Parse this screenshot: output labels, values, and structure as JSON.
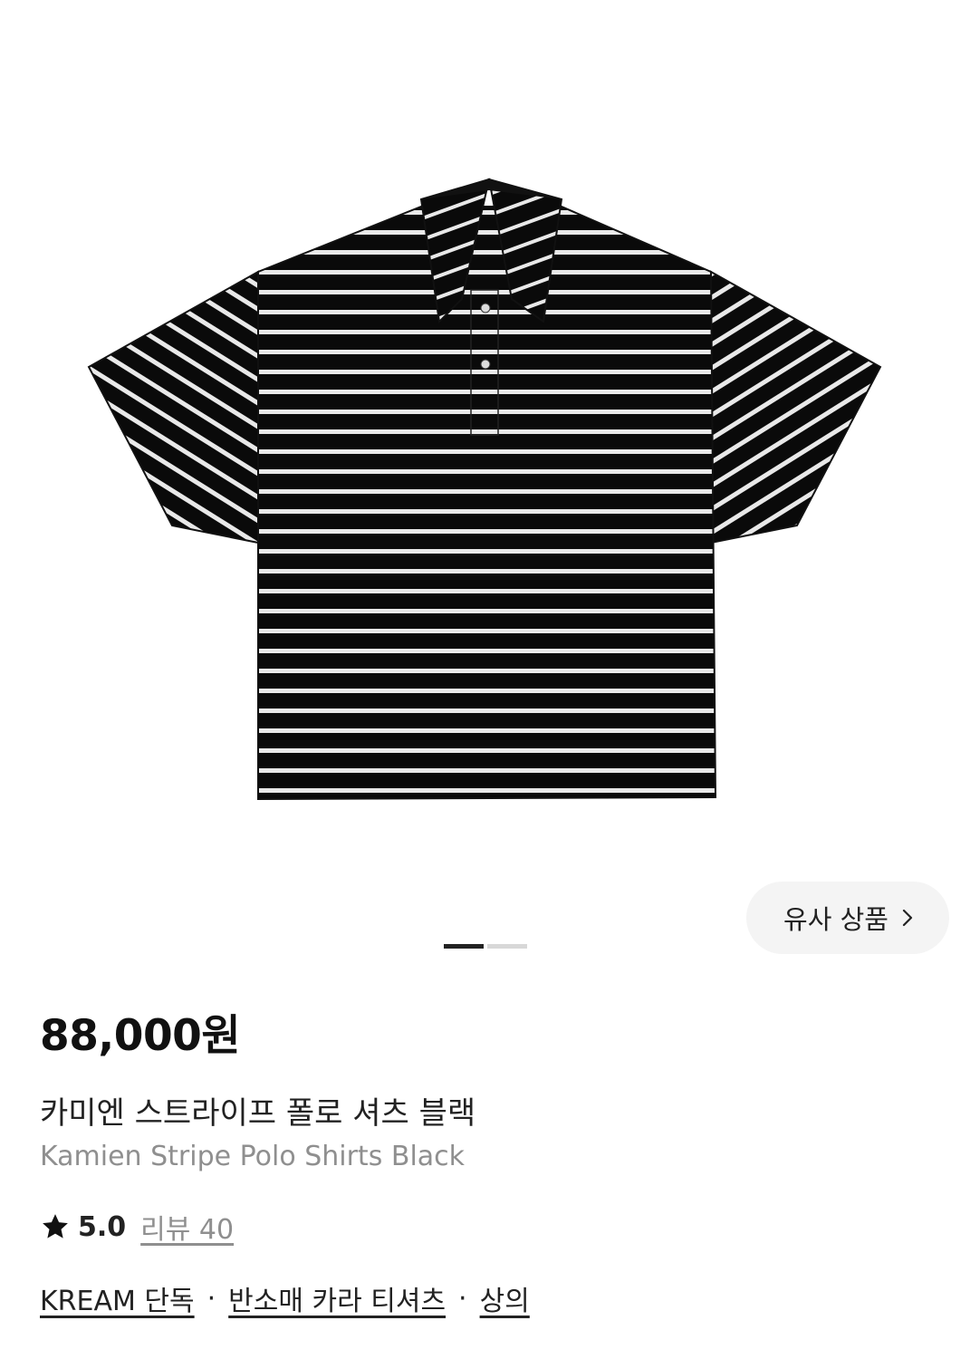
{
  "gallery": {
    "similar_button_label": "유사 상품",
    "page_indicator": {
      "current": 1,
      "total": 2
    },
    "product_image_alt": "Kamien Stripe Polo Shirts Black"
  },
  "product": {
    "price": "88,000원",
    "name_ko": "카미엔 스트라이프 폴로 셔츠 블랙",
    "name_en": "Kamien Stripe Polo Shirts Black",
    "rating": "5.0",
    "review_label": "리뷰 40",
    "tags": [
      "KREAM 단독",
      "반소매 카라 티셔츠",
      "상의"
    ],
    "tag_separator": "·"
  },
  "icons": {
    "similar_chevron": "chevron-right-icon",
    "rating": "star-icon"
  },
  "colors": {
    "text": "#222222",
    "muted": "#8f8f8f",
    "button_bg": "#f4f4f4",
    "indicator_active": "#222222",
    "indicator_inactive": "#d8d8d8"
  }
}
